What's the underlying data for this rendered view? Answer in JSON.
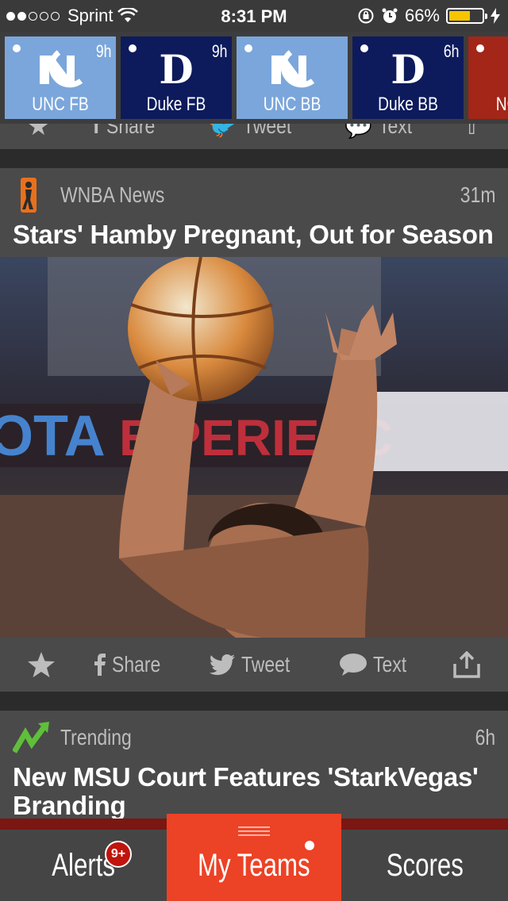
{
  "status_bar": {
    "carrier": "Sprint",
    "time": "8:31 PM",
    "battery": "66%",
    "battery_level": 0.66
  },
  "team_tiles": [
    {
      "name": "UNC FB",
      "age": "9h",
      "color": "#7ba6db",
      "logo": "NC"
    },
    {
      "name": "Duke FB",
      "age": "9h",
      "color": "#0d1b5c",
      "logo": "D"
    },
    {
      "name": "UNC BB",
      "age": "",
      "color": "#7ba6db",
      "logo": "NC"
    },
    {
      "name": "Duke BB",
      "age": "6h",
      "color": "#0d1b5c",
      "logo": "D"
    },
    {
      "name": "NC",
      "age": "",
      "color": "#a32618",
      "logo": ""
    }
  ],
  "share_actions": {
    "share": "Share",
    "tweet": "Tweet",
    "text": "Text"
  },
  "stories": [
    {
      "source": "WNBA News",
      "age": "31m",
      "headline": "Stars' Hamby Pregnant, Out for Season",
      "photo_text": "TA EXPERIENCE"
    },
    {
      "source": "Trending",
      "age": "6h",
      "headline": "New MSU Court Features 'StarkVegas' Branding"
    }
  ],
  "tabs": {
    "alerts": "Alerts",
    "alerts_badge": "9+",
    "my_teams": "My Teams",
    "scores": "Scores"
  },
  "colors": {
    "accent": "#ec4226",
    "unc_blue": "#7ba6db",
    "duke_navy": "#0d1b5c"
  }
}
